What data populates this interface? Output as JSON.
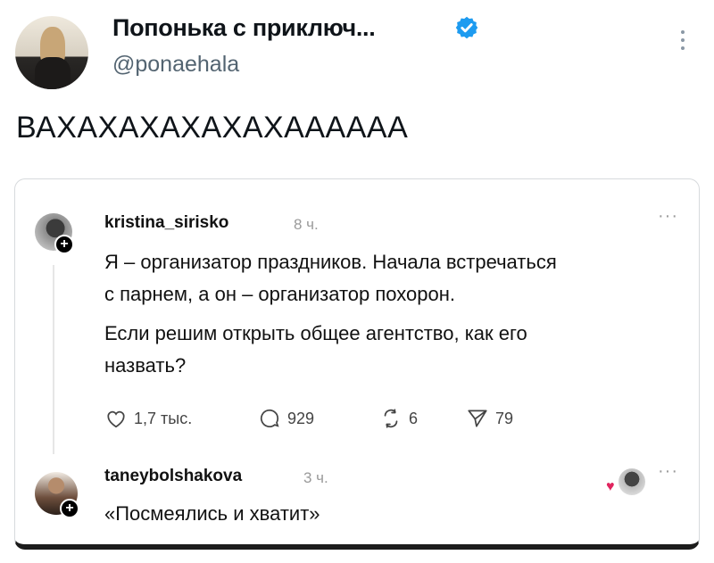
{
  "tweet": {
    "display_name": "Попонька с приключ...",
    "handle": "@ponaehala",
    "text": "ВАХАХАХАХАХАХАААААА"
  },
  "embedded_post": {
    "author": "kristina_sirisko",
    "time": "8 ч.",
    "more": "···",
    "lines": [
      "Я – организатор праздников. Начала встречаться",
      "с парнем, а он – организатор похорон.",
      "Если решим открыть общее агентство, как его",
      "назвать?"
    ],
    "actions": {
      "likes": "1,7 тыс.",
      "replies": "929",
      "reposts": "6",
      "shares": "79"
    }
  },
  "reply": {
    "author": "taneybolshakova",
    "time": "3 ч.",
    "more": "···",
    "text": "«Посмеялись и хватит»"
  },
  "colors": {
    "verified": "#1d9bf0",
    "heart": "#e0245e",
    "muted": "#536471"
  }
}
